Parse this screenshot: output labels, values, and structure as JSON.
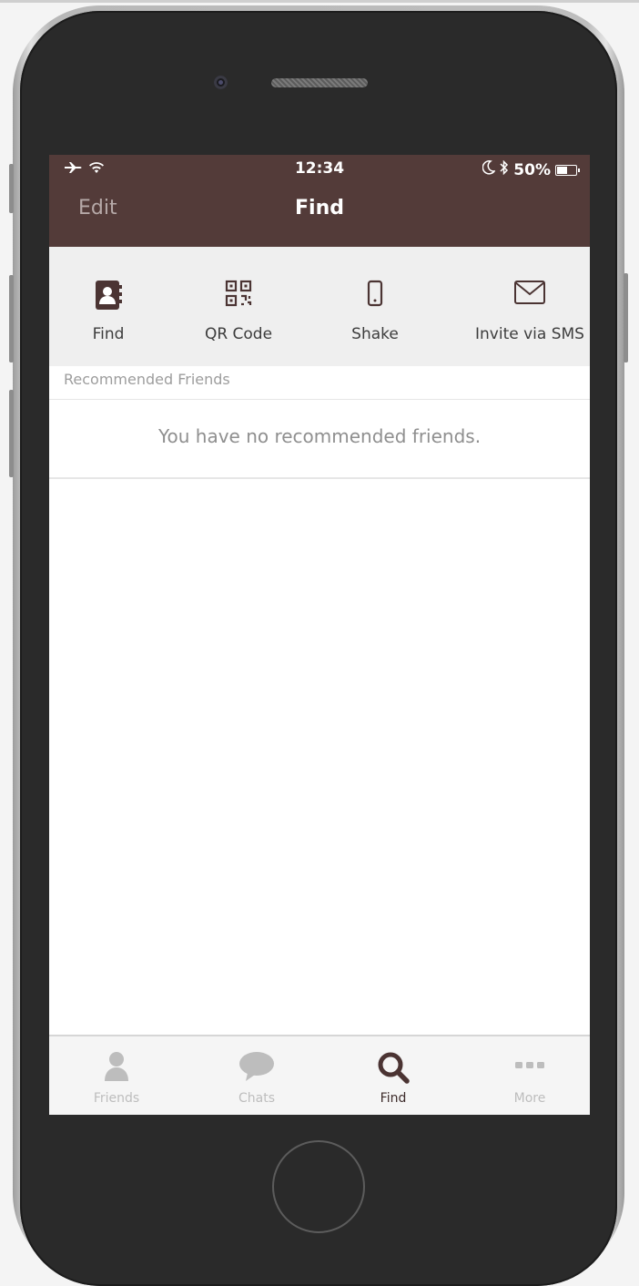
{
  "status_bar": {
    "time": "12:34",
    "battery": "50%",
    "airplane_icon": "airplane-icon",
    "wifi_icon": "wifi-icon",
    "moon_icon": "moon-icon",
    "bluetooth_icon": "bluetooth-icon"
  },
  "nav": {
    "edit_label": "Edit",
    "title": "Find"
  },
  "actions": [
    {
      "label": "Find",
      "icon": "contact-book-icon"
    },
    {
      "label": "QR Code",
      "icon": "qr-code-icon"
    },
    {
      "label": "Shake",
      "icon": "phone-icon"
    },
    {
      "label": "Invite via SMS",
      "icon": "envelope-icon"
    }
  ],
  "recommended": {
    "header": "Recommended Friends",
    "empty_message": "You have no recommended friends."
  },
  "tabs": [
    {
      "label": "Friends",
      "icon": "person-icon",
      "active": false
    },
    {
      "label": "Chats",
      "icon": "chat-bubble-icon",
      "active": false
    },
    {
      "label": "Find",
      "icon": "search-icon",
      "active": true
    },
    {
      "label": "More",
      "icon": "more-dots-icon",
      "active": false
    }
  ],
  "colors": {
    "header_bg": "#533b39",
    "accent": "#4b3433",
    "inactive_tab": "#bdbdbd",
    "action_bar_bg": "#efefef"
  }
}
